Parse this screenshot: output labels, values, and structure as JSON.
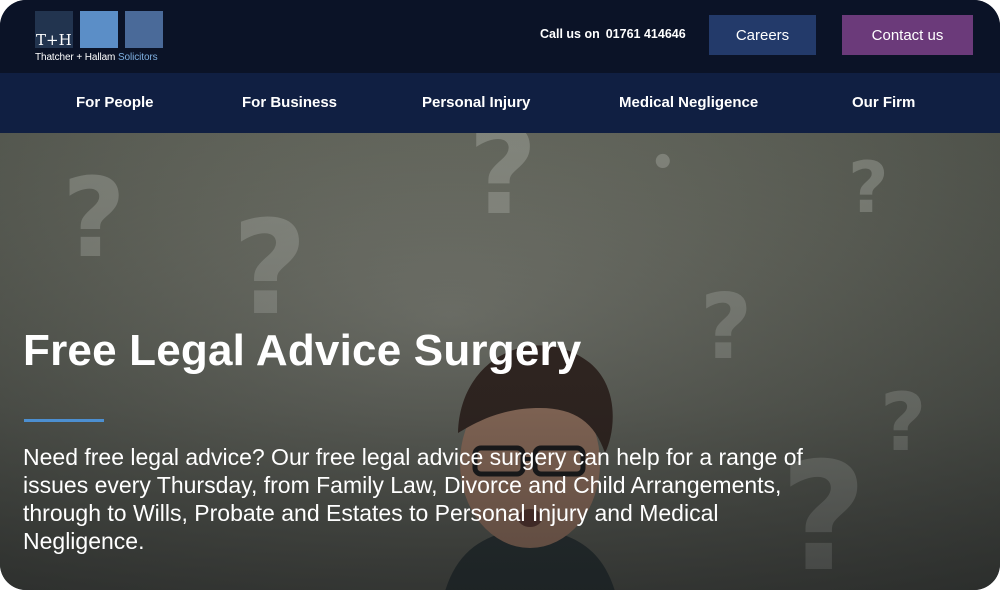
{
  "brand": {
    "logo_mark": "T+H",
    "name_main": "Thatcher + Hallam",
    "name_suffix": "Solicitors"
  },
  "header": {
    "call_label": "Call us on",
    "phone": "01761 414646",
    "careers_label": "Careers",
    "contact_label": "Contact us"
  },
  "nav": {
    "items": [
      {
        "label": "For People"
      },
      {
        "label": "For Business"
      },
      {
        "label": "Personal Injury"
      },
      {
        "label": "Medical Negligence"
      },
      {
        "label": "Our Firm"
      }
    ]
  },
  "hero": {
    "title": "Free Legal Advice Surgery",
    "body": "Need free legal advice? Our free legal advice surgery can help for a range of issues every Thursday, from Family Law, Divorce and Child Arrangements, through to Wills, Probate and Estates to Personal Injury and Medical Negligence."
  },
  "colors": {
    "topbar_bg": "#0b1327",
    "nav_bg": "#101f42",
    "careers_bg": "#233a6a",
    "contact_bg": "#6b3a7a",
    "accent": "#4c8fd1"
  }
}
